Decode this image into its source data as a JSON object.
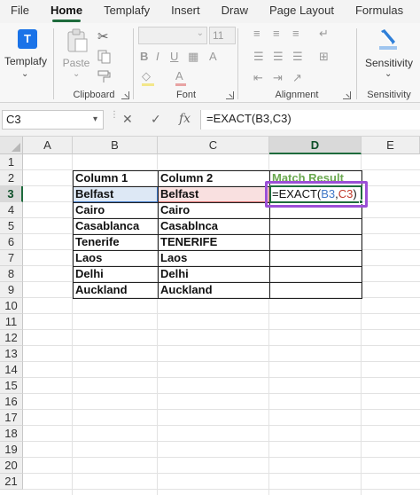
{
  "menu": {
    "tabs": [
      "File",
      "Home",
      "Templafy",
      "Insert",
      "Draw",
      "Page Layout",
      "Formulas"
    ],
    "active_tab": "Home"
  },
  "ribbon": {
    "templafy": {
      "label": "Templafy",
      "icon": "templafy-icon"
    },
    "clipboard": {
      "group_label": "Clipboard",
      "paste_label": "Paste",
      "icons": [
        "paste-icon",
        "cut-icon",
        "copy-icon",
        "format-painter-icon"
      ]
    },
    "font": {
      "group_label": "Font",
      "font_size": "11",
      "buttons": [
        "B",
        "I",
        "U"
      ]
    },
    "alignment": {
      "group_label": "Alignment"
    },
    "sensitivity": {
      "group_label": "Sensitivity",
      "label": "Sensitivity",
      "icon": "sensitivity-icon"
    }
  },
  "formula_bar": {
    "name_box": "C3",
    "formula": "=EXACT(B3,C3)",
    "icons": [
      "cancel-icon",
      "enter-icon",
      "function-icon"
    ]
  },
  "sheet": {
    "columns": [
      "A",
      "B",
      "C",
      "D",
      "E"
    ],
    "active_column": "D",
    "rows": [
      "1",
      "2",
      "3",
      "4",
      "5",
      "6",
      "7",
      "8",
      "9",
      "10",
      "11",
      "12",
      "13",
      "14",
      "15",
      "16",
      "17",
      "18",
      "19",
      "20",
      "21"
    ],
    "active_row": "3",
    "table": {
      "headers": [
        "Column 1",
        "Column 2",
        "Match Result"
      ],
      "header_colors": [
        "#111111",
        "#111111",
        "#6aa84f"
      ],
      "rows": [
        [
          "Belfast",
          "Belfast"
        ],
        [
          "Cairo",
          "Cairo"
        ],
        [
          "Casablanca",
          "Casablnca"
        ],
        [
          "Tenerife",
          "TENERIFE"
        ],
        [
          "Laos",
          "Laos"
        ],
        [
          "Delhi",
          "Delhi"
        ],
        [
          "Auckland",
          "Auckland"
        ]
      ]
    },
    "editing_cell": {
      "prefix": "=EXACT(",
      "ref1": "B3",
      "sep": ",",
      "ref2": "C3",
      "suffix": ")"
    }
  }
}
